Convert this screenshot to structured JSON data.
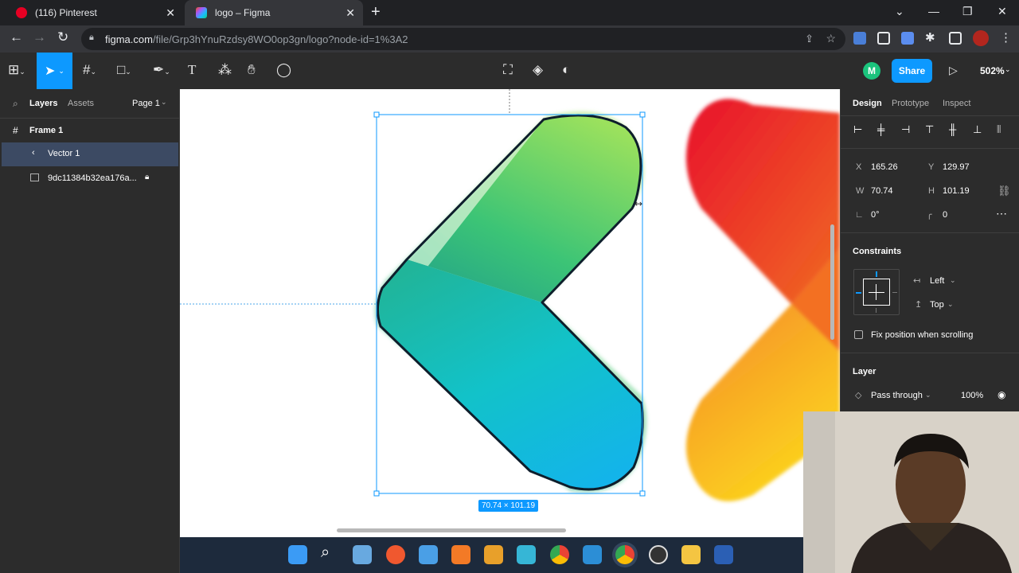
{
  "browser": {
    "tabs": [
      {
        "title": "(116) Pinterest",
        "close": "✕"
      },
      {
        "title": "logo – Figma",
        "close": "✕"
      }
    ],
    "new_tab": "+",
    "window_controls": {
      "minimize": "—",
      "restore": "❐",
      "close": "✕"
    },
    "url_host": "figma.com",
    "url_path": "/file/Grp3hYnuRzdsy8WO0op3gn/logo?node-id=1%3A2"
  },
  "figma": {
    "avatar_initial": "M",
    "share_label": "Share",
    "zoom_level": "502%",
    "left_panel": {
      "tabs": [
        "Layers",
        "Assets"
      ],
      "page_selector": "Page 1",
      "layers": [
        {
          "name": "Frame 1",
          "icon": "frame-icon"
        },
        {
          "name": "Vector 1",
          "icon": "vector-icon",
          "selected": true
        },
        {
          "name": "9dc11384b32ea176a...",
          "icon": "image-icon",
          "locked": true
        }
      ]
    },
    "canvas": {
      "selection_size": "70.74 × 101.19"
    },
    "right_panel": {
      "tabs": [
        "Design",
        "Prototype",
        "Inspect"
      ],
      "x_label": "X",
      "x_value": "165.26",
      "y_label": "Y",
      "y_value": "129.97",
      "w_label": "W",
      "w_value": "70.74",
      "h_label": "H",
      "h_value": "101.19",
      "rotation_value": "0°",
      "radius_value": "0",
      "constraints_title": "Constraints",
      "constraint_h": "Left",
      "constraint_v": "Top",
      "fix_position_label": "Fix position when scrolling",
      "layer_title": "Layer",
      "blend_mode": "Pass through",
      "opacity": "100%"
    }
  },
  "colors": {
    "figma_blue": "#0d99ff",
    "selected_layer": "#3c4a63",
    "avatar_green": "#1bc47d"
  }
}
